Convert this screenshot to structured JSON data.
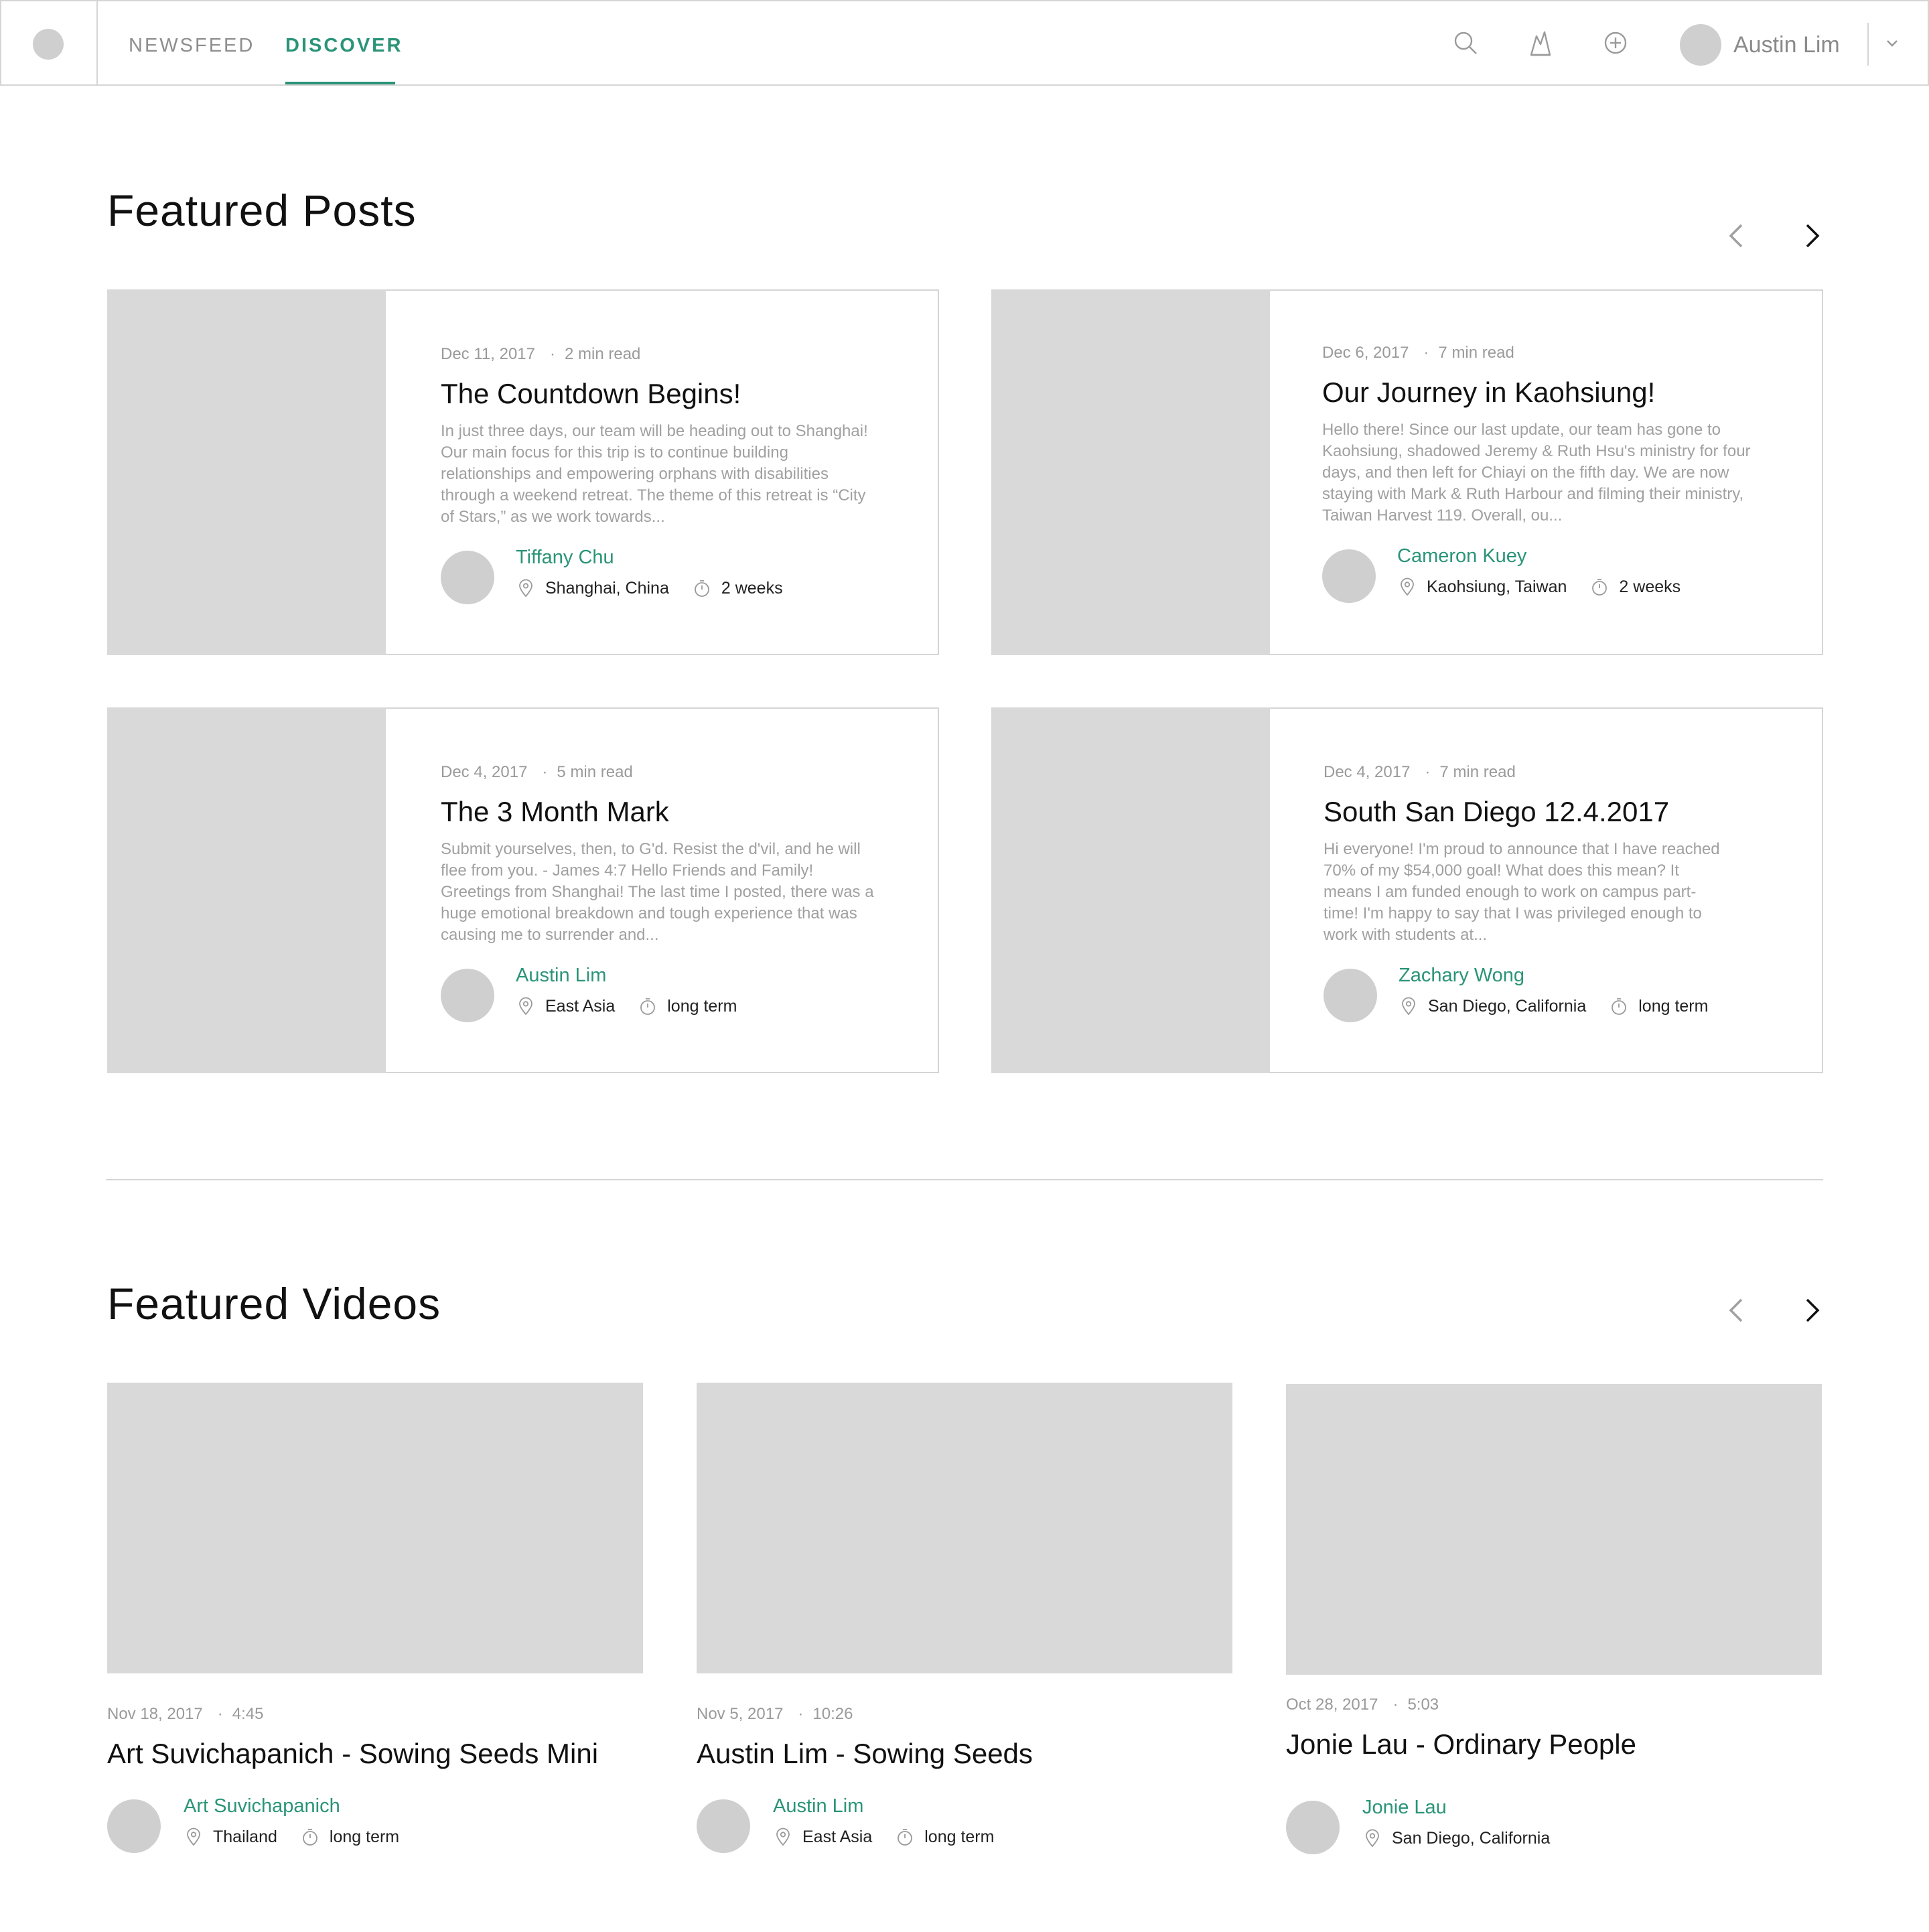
{
  "header": {
    "tabs": [
      {
        "label": "NEWSFEED",
        "active": false
      },
      {
        "label": "DISCOVER",
        "active": true
      }
    ],
    "icons": [
      "search-icon",
      "trending-icon",
      "add-circle-icon",
      "chevron-down-icon"
    ],
    "user_name": "Austin Lim",
    "accent_color": "#2a9478"
  },
  "featured_posts": {
    "title": "Featured Posts",
    "posts": [
      {
        "date": "Dec 11, 2017",
        "read_time": "2 min read",
        "title": "The Countdown Begins!",
        "excerpt": "In just three days, our team will be heading out to Shanghai! Our main focus for this trip is to continue building relationships and empowering orphans with disabilities through a weekend retreat. The theme of this retreat is “City of Stars,” as we work towards...",
        "author": "Tiffany Chu",
        "location": "Shanghai, China",
        "duration": "2 weeks"
      },
      {
        "date": "Dec 6, 2017",
        "read_time": "7 min read",
        "title": "Our Journey in Kaohsiung!",
        "excerpt": "Hello there! Since our last update, our team has gone to Kaohsiung, shadowed Jeremy & Ruth Hsu's ministry for four days, and then left for Chiayi on the fifth day. We are now staying with Mark & Ruth Harbour and filming their ministry, Taiwan Harvest 119. Overall, ou...",
        "author": "Cameron Kuey",
        "location": "Kaohsiung, Taiwan",
        "duration": "2 weeks"
      },
      {
        "date": "Dec 4, 2017",
        "read_time": "5 min read",
        "title": "The 3 Month Mark",
        "excerpt": "Submit yourselves, then, to G'd. Resist the d'vil, and he will flee from you. - James 4:7 Hello Friends and Family! Greetings from Shanghai! The last time I posted, there was a huge emotional breakdown and tough experience that was causing me to surrender and...",
        "author": "Austin Lim",
        "location": "East Asia",
        "duration": "long term"
      },
      {
        "date": "Dec 4, 2017",
        "read_time": "7 min read",
        "title": "South San Diego 12.4.2017",
        "excerpt": "Hi everyone! I'm proud to announce that I have reached 70% of my $54,000 goal! What does this mean? It means I am funded enough to work on campus part-time! I'm happy to say that I was privileged enough to work with students at...",
        "author": "Zachary Wong",
        "location": "San Diego, California",
        "duration": "long term"
      }
    ]
  },
  "featured_videos": {
    "title": "Featured Videos",
    "videos": [
      {
        "date": "Nov 18, 2017",
        "length": "4:45",
        "title": "Art Suvichapanich - Sowing Seeds Mini",
        "author": "Art Suvichapanich",
        "location": "Thailand",
        "duration": "long term"
      },
      {
        "date": "Nov 5, 2017",
        "length": "10:26",
        "title": "Austin Lim - Sowing Seeds",
        "author": "Austin Lim",
        "location": "East Asia",
        "duration": "long term"
      },
      {
        "date": "Oct 28, 2017",
        "length": "5:03",
        "title": "Jonie Lau - Ordinary People",
        "author": "Jonie Lau",
        "location": "San Diego, California",
        "duration": ""
      }
    ]
  }
}
